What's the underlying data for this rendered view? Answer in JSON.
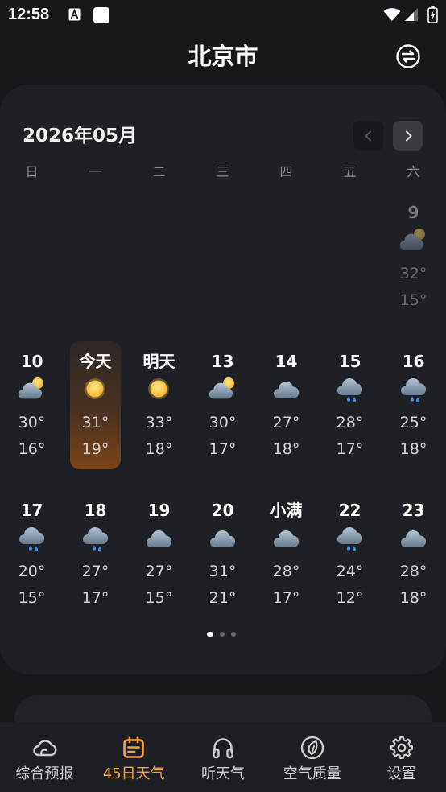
{
  "status_bar": {
    "time": "12:58",
    "notification_icons": [
      "text-a-icon",
      "app-square-icon"
    ],
    "system_icons": [
      "wifi-icon",
      "signal-icon",
      "battery-icon"
    ]
  },
  "header": {
    "city": "北京市",
    "action_icon": "switch-city-icon"
  },
  "calendar": {
    "month_label": "2026年05月",
    "prev_icon": "chevron-left-icon",
    "next_icon": "chevron-right-icon",
    "weekdays": [
      "日",
      "一",
      "二",
      "三",
      "四",
      "五",
      "六"
    ],
    "weeks": [
      [
        null,
        null,
        null,
        null,
        null,
        null,
        {
          "label": "9",
          "icon": "partly-cloudy-icon",
          "high": "32°",
          "low": "15°",
          "is_past": true
        }
      ],
      [
        {
          "label": "10",
          "icon": "partly-cloudy-icon",
          "high": "30°",
          "low": "16°"
        },
        {
          "label": "今天",
          "icon": "sun-icon",
          "high": "31°",
          "low": "19°",
          "is_today": true
        },
        {
          "label": "明天",
          "icon": "sun-icon",
          "high": "33°",
          "low": "18°"
        },
        {
          "label": "13",
          "icon": "partly-cloudy-icon",
          "high": "30°",
          "low": "17°"
        },
        {
          "label": "14",
          "icon": "cloud-icon",
          "high": "27°",
          "low": "18°"
        },
        {
          "label": "15",
          "icon": "rain-icon",
          "high": "28°",
          "low": "17°"
        },
        {
          "label": "16",
          "icon": "rain-icon",
          "high": "25°",
          "low": "18°"
        }
      ],
      [
        {
          "label": "17",
          "icon": "rain-icon",
          "high": "20°",
          "low": "15°"
        },
        {
          "label": "18",
          "icon": "rain-icon",
          "high": "27°",
          "low": "17°"
        },
        {
          "label": "19",
          "icon": "cloud-icon",
          "high": "27°",
          "low": "15°"
        },
        {
          "label": "20",
          "icon": "cloud-icon",
          "high": "31°",
          "low": "21°"
        },
        {
          "label": "小满",
          "icon": "cloud-icon",
          "high": "28°",
          "low": "17°"
        },
        {
          "label": "22",
          "icon": "rain-icon",
          "high": "24°",
          "low": "12°"
        },
        {
          "label": "23",
          "icon": "cloud-icon",
          "high": "28°",
          "low": "18°"
        }
      ]
    ],
    "pager": {
      "count": 3,
      "active": 0
    }
  },
  "bottom_nav": {
    "active_index": 1,
    "items": [
      {
        "label": "综合预报",
        "icon": "cloud-outline-icon"
      },
      {
        "label": "45日天气",
        "icon": "calendar-icon"
      },
      {
        "label": "听天气",
        "icon": "headphones-icon"
      },
      {
        "label": "空气质量",
        "icon": "leaf-icon"
      },
      {
        "label": "设置",
        "icon": "gear-icon"
      }
    ]
  },
  "colors": {
    "background": "#17181c",
    "card": "#1f2025",
    "accent": "#f5a43a",
    "today_top": "#2d2725",
    "today_bottom": "#7a4418",
    "text_secondary": "#d6d6d6",
    "text_muted": "#8b8b90",
    "sun": "#f7c948",
    "cloud": "#8da0b4",
    "rain_drop": "#3d8ee6"
  }
}
